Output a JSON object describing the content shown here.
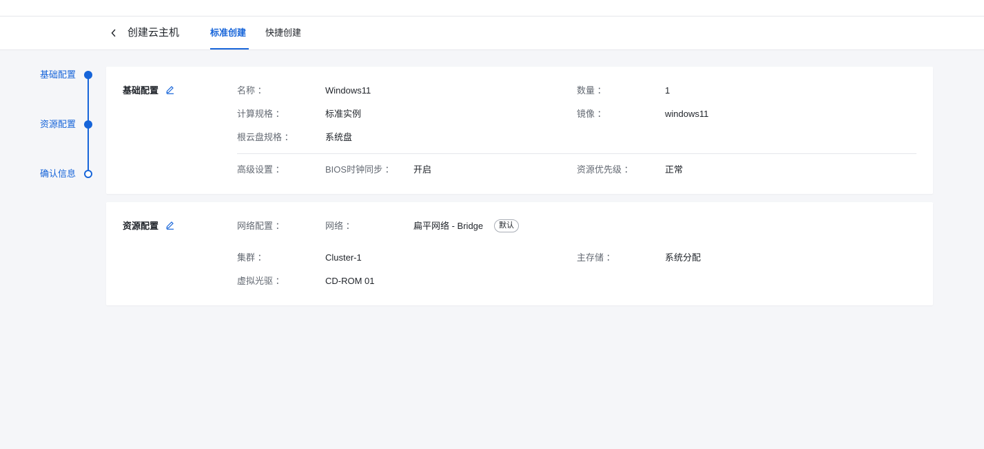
{
  "header": {
    "title": "创建云主机",
    "tabs": [
      {
        "label": "标准创建",
        "active": true
      },
      {
        "label": "快捷创建",
        "active": false
      }
    ]
  },
  "steps": [
    {
      "label": "基础配置",
      "state": "done"
    },
    {
      "label": "资源配置",
      "state": "done"
    },
    {
      "label": "确认信息",
      "state": "current"
    }
  ],
  "basic": {
    "title": "基础配置",
    "name_label": "名称 ：",
    "name_value": "Windows11",
    "count_label": "数量 ：",
    "count_value": "1",
    "spec_label": "计算规格 ：",
    "spec_value": "标准实例",
    "image_label": "镜像 ：",
    "image_value": "windows11",
    "disk_label": "根云盘规格 ：",
    "disk_value": "系统盘",
    "advanced_label": "高级设置 ：",
    "bios_label": "BIOS时钟同步 ：",
    "bios_value": "开启",
    "priority_label": "资源优先级 ：",
    "priority_value": "正常"
  },
  "resource": {
    "title": "资源配置",
    "network_cfg_label": "网络配置 ：",
    "network_label": "网络 ：",
    "network_value": "扁平网络 - Bridge",
    "network_badge": "默认",
    "cluster_label": "集群 ：",
    "cluster_value": "Cluster-1",
    "storage_label": "主存储 ：",
    "storage_value": "系统分配",
    "cdrom_label": "虚拟光驱 ：",
    "cdrom_value": "CD-ROM 01"
  },
  "colors": {
    "accent": "#1664d9",
    "background": "#f5f6f9"
  }
}
